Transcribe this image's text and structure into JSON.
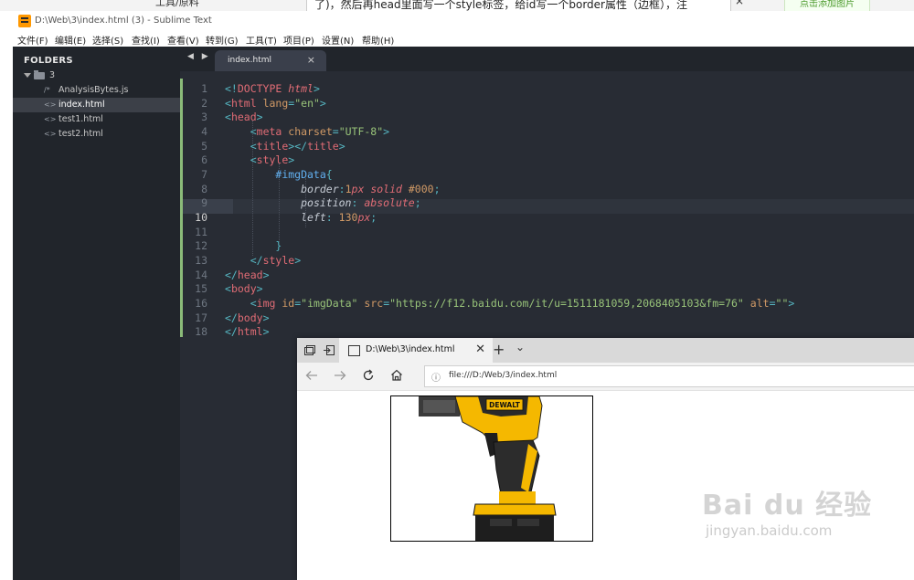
{
  "bg_page": {
    "left_text": "工具/原料",
    "center_text": "了)，然后再head里面写一个style标签，给id写一个border属性（边框），注",
    "close_symbol": "×",
    "button_text": "点击添加图片"
  },
  "window": {
    "title": "D:\\Web\\3\\index.html (3) - Sublime Text"
  },
  "menu": [
    "文件(F)",
    "编辑(E)",
    "选择(S)",
    "查找(I)",
    "查看(V)",
    "转到(G)",
    "工具(T)",
    "项目(P)",
    "设置(N)",
    "帮助(H)"
  ],
  "sidebar": {
    "title": "FOLDERS",
    "folder": "3",
    "files": [
      {
        "icon": "/*",
        "name": "AnalysisBytes.js",
        "selected": false
      },
      {
        "icon": "<>",
        "name": "index.html",
        "selected": true
      },
      {
        "icon": "<>",
        "name": "test1.html",
        "selected": false
      },
      {
        "icon": "<>",
        "name": "test2.html",
        "selected": false
      }
    ]
  },
  "tabbar": {
    "nav": "◀ ▶",
    "tab_label": "index.html",
    "tab_close": "×"
  },
  "editor": {
    "current_line": 10,
    "line_numbers": [
      "1",
      "2",
      "3",
      "4",
      "5",
      "6",
      "7",
      "8",
      "9",
      "10",
      "11",
      "12",
      "13",
      "14",
      "15",
      "16",
      "17",
      "18"
    ],
    "lines": [
      "<!DOCTYPE html>",
      "<html lang=\"en\">",
      "<head>",
      "    <meta charset=\"UTF-8\">",
      "    <title></title>",
      "    <style>",
      "        #imgData{",
      "            border:1px solid #000;",
      "            position: absolute;",
      "            left: 130px;",
      "",
      "        }",
      "    </style>",
      "</head>",
      "<body>",
      "    <img id=\"imgData\" src=\"https://f12.baidu.com/it/u=1511181059,2068405103&fm=76\" alt=\"\">",
      "</body>",
      "</html>"
    ]
  },
  "browser": {
    "tab_title": "D:\\Web\\3\\index.html",
    "tab_close": "✕",
    "new_tab": "+",
    "tab_menu": "⌄",
    "address": "file:///D:/Web/3/index.html",
    "info_icon": "ⓘ"
  },
  "watermark": {
    "main": "Bai du 经验",
    "sub": "jingyan.baidu.com"
  },
  "colors": {
    "editor_bg": "#282c34",
    "sidebar_bg": "#21252b",
    "tag": "#e06c75",
    "attr": "#d19a66",
    "string": "#98c379",
    "punct": "#56b6c2",
    "selector": "#61afef",
    "tool_yellow": "#f5b800"
  }
}
